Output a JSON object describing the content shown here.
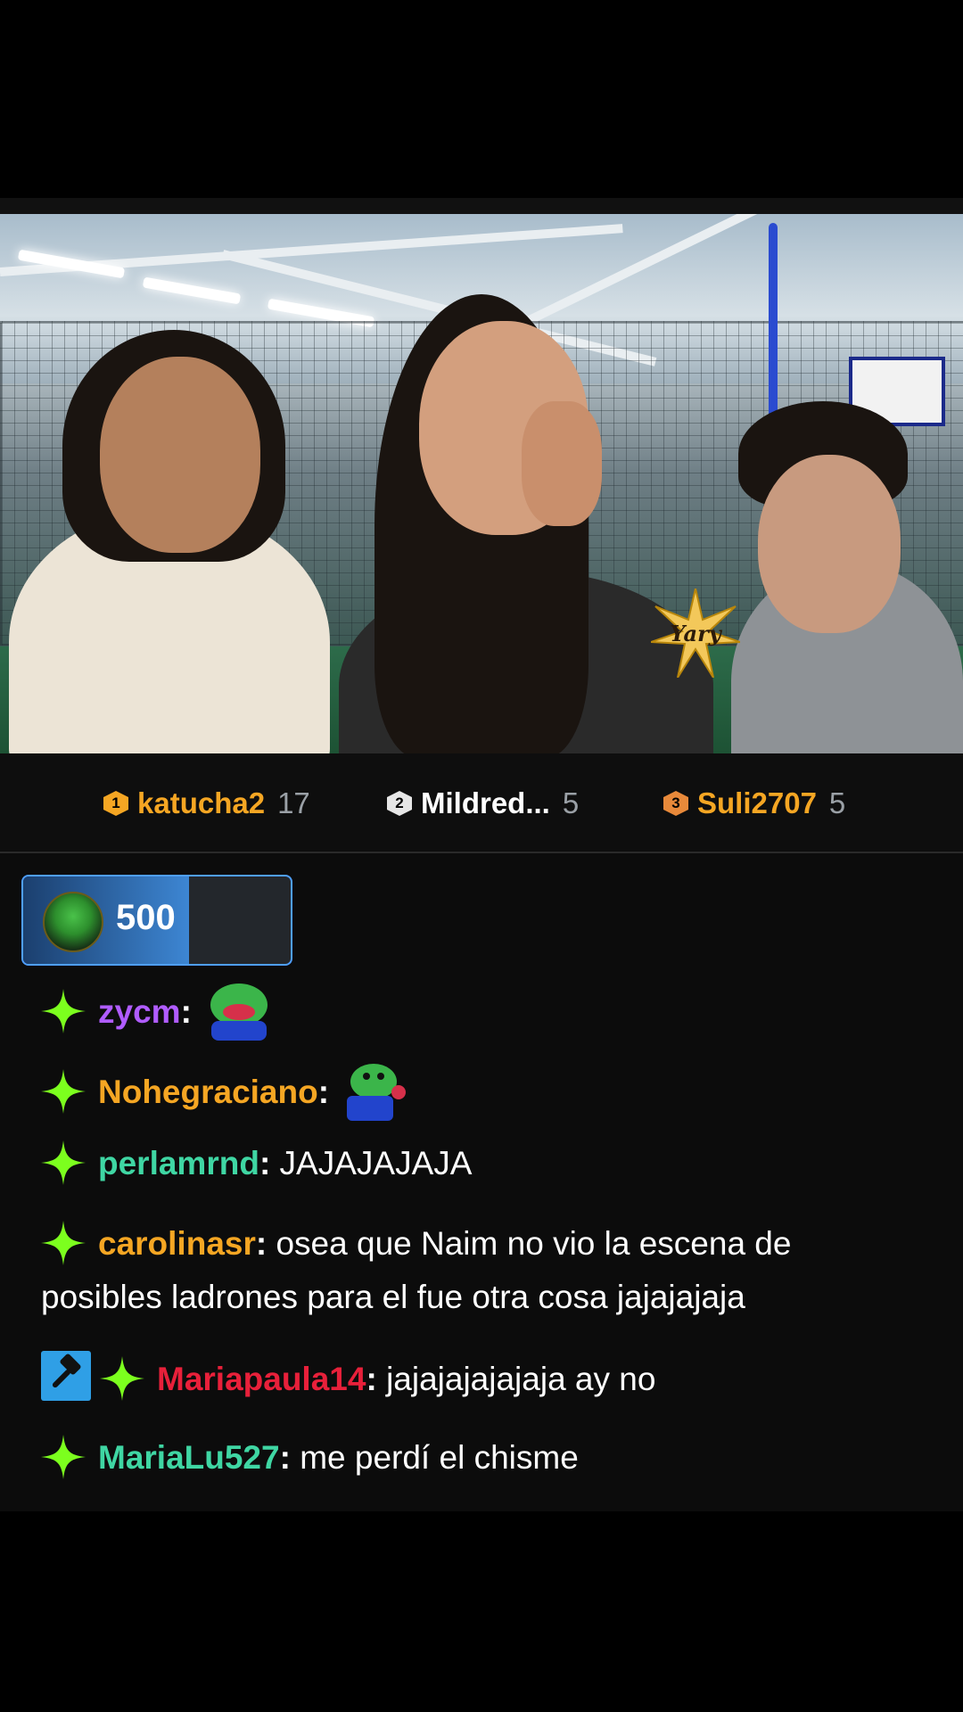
{
  "leaderboard": [
    {
      "rank": "1",
      "name": "katucha2",
      "count": "17",
      "name_color": "#f5a623",
      "badge_color": "#f5a623"
    },
    {
      "rank": "2",
      "name": "Mildred...",
      "count": "5",
      "name_color": "#ffffff",
      "badge_color": "#e6e6e6"
    },
    {
      "rank": "3",
      "name": "Suli2707",
      "count": "5",
      "name_color": "#f5a623",
      "badge_color": "#e8893a"
    }
  ],
  "gift": {
    "amount": "500",
    "progress": 0.62
  },
  "watermark": {
    "text": "Yary"
  },
  "chat": [
    {
      "user": "zycm",
      "color": "#b05cff",
      "text": "",
      "emote": "pepe-laugh-emote"
    },
    {
      "user": "Nohegraciano",
      "color": "#f5a623",
      "text": "",
      "emote": "pepe-rose-emote"
    },
    {
      "user": "perlamrnd",
      "color": "#3fd6a3",
      "text": "JAJAJAJAJA"
    },
    {
      "user": "carolinasr",
      "color": "#f5a623",
      "text": "osea que Naim no vio la escena de",
      "text_line2": "posibles ladrones para el fue otra cosa jajajajaja"
    },
    {
      "user": "Mariapaula14",
      "color": "#e8203a",
      "text": "jajajajajajaja ay no",
      "mod": true
    },
    {
      "user": "MariaLu527",
      "color": "#3fd6a3",
      "text": "me perdí el chisme"
    }
  ],
  "colors": {
    "star_icon": "#7cff1e",
    "mod_badge": "#2f9fe6",
    "gift_border": "#4f9fff"
  }
}
